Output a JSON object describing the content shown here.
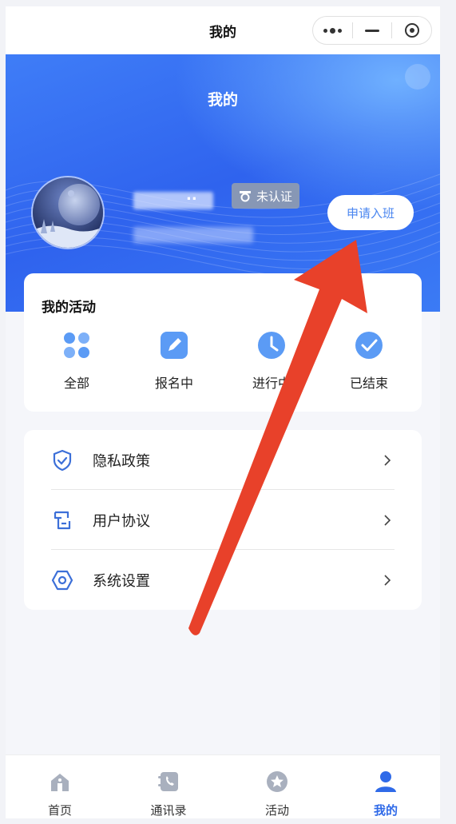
{
  "navbar": {
    "title": "我的"
  },
  "profile": {
    "header_title": "我的",
    "name_suffix": "..",
    "verify_badge": "未认证",
    "apply_button": "申请入班"
  },
  "activities": {
    "title": "我的活动",
    "items": [
      {
        "label": "全部",
        "icon": "grid-icon"
      },
      {
        "label": "报名中",
        "icon": "edit-icon"
      },
      {
        "label": "进行中",
        "icon": "clock-icon"
      },
      {
        "label": "已结束",
        "icon": "check-icon"
      }
    ]
  },
  "menu": {
    "items": [
      {
        "label": "隐私政策",
        "icon": "shield-icon"
      },
      {
        "label": "用户协议",
        "icon": "document-icon"
      },
      {
        "label": "系统设置",
        "icon": "hexagon-settings-icon"
      }
    ]
  },
  "tabbar": {
    "items": [
      {
        "label": "首页",
        "icon": "home-icon"
      },
      {
        "label": "通讯录",
        "icon": "contacts-icon"
      },
      {
        "label": "活动",
        "icon": "star-icon"
      },
      {
        "label": "我的",
        "icon": "user-icon",
        "active": true
      }
    ]
  },
  "colors": {
    "accent": "#2f6ae8",
    "banner": "#3b72f2",
    "annotation_arrow": "#e8412a"
  }
}
